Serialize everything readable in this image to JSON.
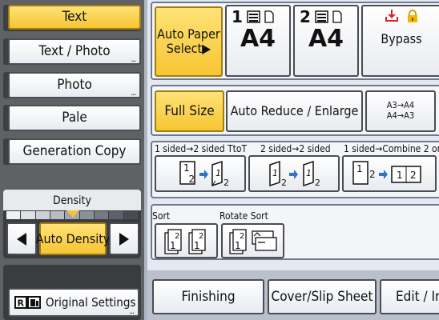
{
  "original_modes": [
    {
      "label": "Text",
      "selected": true,
      "has_more": false
    },
    {
      "label": "Text / Photo",
      "selected": false,
      "has_more": true
    },
    {
      "label": "Photo",
      "selected": false,
      "has_more": true
    },
    {
      "label": "Pale",
      "selected": false,
      "has_more": false
    },
    {
      "label": "Generation Copy",
      "selected": false,
      "has_more": false
    }
  ],
  "density": {
    "title": "Density",
    "auto_label": "Auto Density",
    "levels": 9,
    "indicator_level": 5
  },
  "original_settings": {
    "label": "Original Settings",
    "icon": "original-settings-icon"
  },
  "paper": {
    "auto_label_line1": "Auto Paper",
    "auto_label_line2": "Select▶",
    "trays": [
      {
        "number": "1",
        "size": "A4"
      },
      {
        "number": "2",
        "size": "A4"
      }
    ],
    "bypass_label": "Bypass"
  },
  "reduce_enlarge": {
    "full_size": "Full Size",
    "auto_reduce": "Auto Reduce / Enlarge",
    "preset_line1": "A3→A4",
    "preset_line2": "A4→A3"
  },
  "duplex": [
    {
      "label": "1 sided→2 sided TtoT"
    },
    {
      "label": "2 sided→2 sided"
    },
    {
      "label": "1 sided→Combine 2 ori"
    }
  ],
  "sort": {
    "sort_label": "Sort",
    "rotate_label": "Rotate Sort"
  },
  "tabs": [
    {
      "label": "Finishing"
    },
    {
      "label": "Cover/Slip Sheet"
    },
    {
      "label": "Edit / Ir"
    }
  ],
  "colors": {
    "selected": "#f6c532",
    "panel": "#5f6165",
    "main": "#e3e8f1"
  }
}
